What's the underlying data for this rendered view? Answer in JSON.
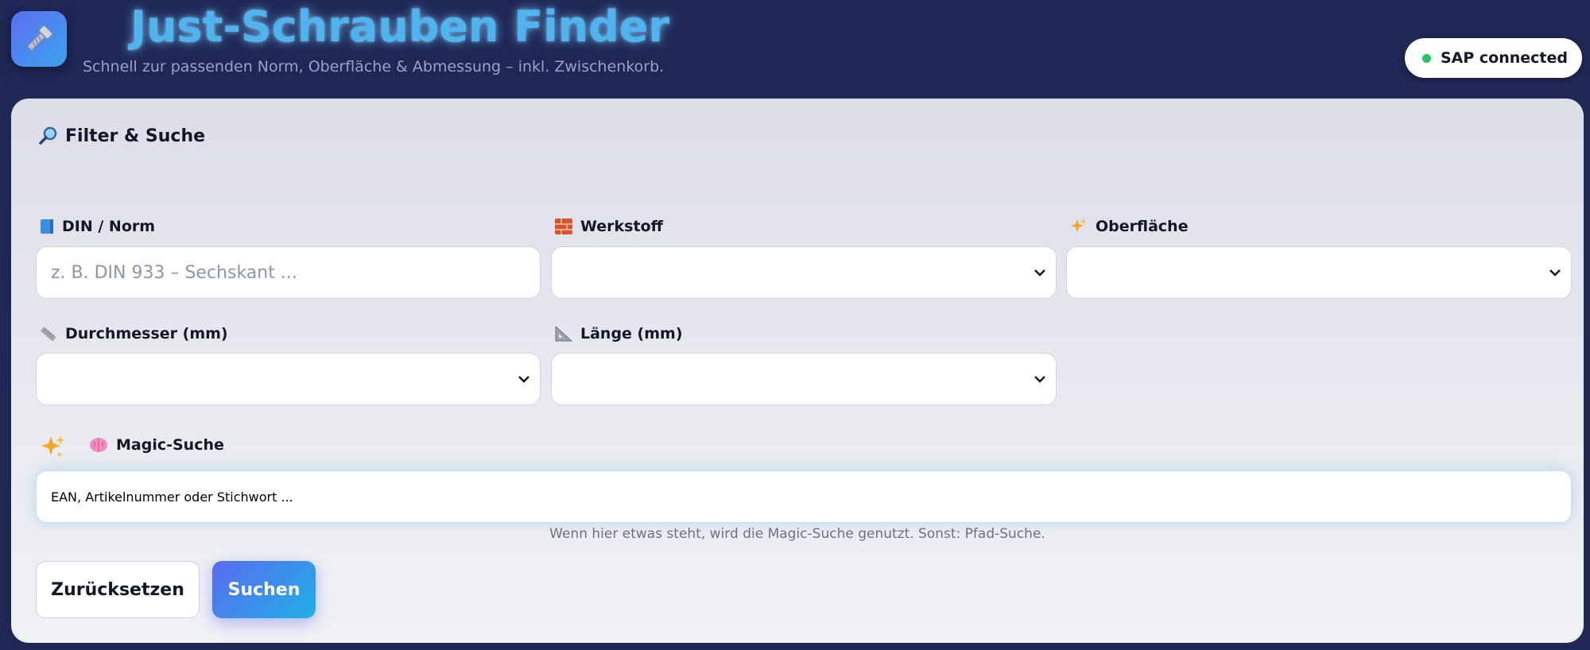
{
  "header": {
    "title": "Just-Schrauben Finder",
    "subtitle": "Schnell zur passenden Norm, Oberfläche & Abmessung – inkl. Zwischenkorb.",
    "logo_icon": "bolt-icon",
    "sap_status": "SAP connected",
    "sap_status_color": "#22c55e"
  },
  "panel": {
    "title": "Filter & Suche",
    "title_icon": "magnifier-icon",
    "fields": {
      "din": {
        "label": "DIN / Norm",
        "icon": "book-icon",
        "placeholder": "z. B. DIN 933 – Sechskant ...",
        "value": ""
      },
      "werkstoff": {
        "label": "Werkstoff",
        "icon": "brick-icon",
        "value": ""
      },
      "oberflaeche": {
        "label": "Oberfläche",
        "icon": "sparkles-icon",
        "value": ""
      },
      "durchmesser": {
        "label": "Durchmesser (mm)",
        "icon": "ruler-icon",
        "value": ""
      },
      "laenge": {
        "label": "Länge (mm)",
        "icon": "triangle-ruler-icon",
        "value": ""
      }
    },
    "magic": {
      "label": "Magic-Suche",
      "icon": "brain-icon",
      "placeholder": "EAN, Artikelnummer oder Stichwort ...",
      "hint": "Wenn hier etwas steht, wird die Magic-Suche genutzt. Sonst: Pfad-Suche."
    },
    "buttons": {
      "reset": "Zurücksetzen",
      "search": "Suchen"
    }
  },
  "colors": {
    "background": "#1f2755",
    "title": "#4fb3ee",
    "accent_gradient_start": "#5b6af0",
    "accent_gradient_end": "#1fb0e6"
  }
}
